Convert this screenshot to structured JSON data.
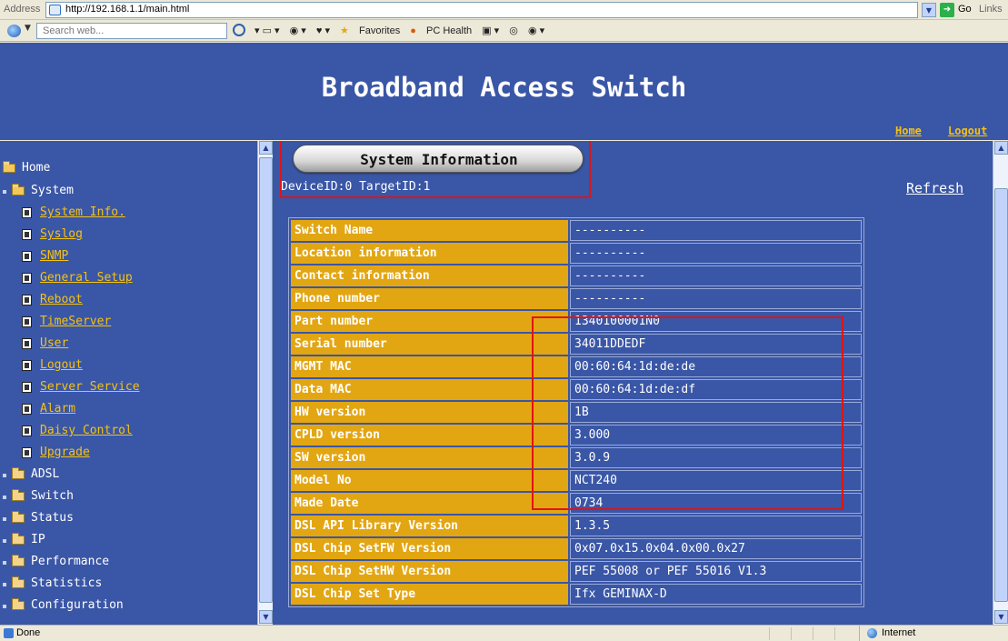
{
  "browser": {
    "address_label": "Address",
    "url": "http://192.168.1.1/main.html",
    "go_label": "Go",
    "links_label": "Links",
    "search_placeholder": "Search web...",
    "favorites_label": "Favorites",
    "pc_health_label": "PC Health",
    "status_text": "Done",
    "zone_text": "Internet"
  },
  "header": {
    "title": "Broadband Access Switch",
    "home_link": "Home",
    "logout_link": "Logout"
  },
  "nav": {
    "root": "Home",
    "system": "System",
    "system_items": [
      "System Info.",
      "Syslog",
      "SNMP",
      "General Setup",
      "Reboot",
      "TimeServer",
      "User",
      "Logout",
      "Server Service",
      "Alarm",
      "Daisy Control",
      "Upgrade"
    ],
    "folders": [
      "ADSL",
      "Switch",
      "Status",
      "IP",
      "Performance",
      "Statistics",
      "Configuration"
    ]
  },
  "main": {
    "section_title": "System Information",
    "device_line": "DeviceID:0 TargetID:1",
    "refresh_label": "Refresh",
    "rows": [
      {
        "key": "Switch Name",
        "value": "----------"
      },
      {
        "key": "Location information",
        "value": "----------"
      },
      {
        "key": "Contact information",
        "value": "----------"
      },
      {
        "key": "Phone number",
        "value": "----------"
      },
      {
        "key": "Part number",
        "value": "1340100001N0"
      },
      {
        "key": "Serial number",
        "value": "34011DDEDF"
      },
      {
        "key": "MGMT MAC",
        "value": "00:60:64:1d:de:de"
      },
      {
        "key": "Data MAC",
        "value": "00:60:64:1d:de:df"
      },
      {
        "key": "HW version",
        "value": "1B"
      },
      {
        "key": "CPLD version",
        "value": "3.000"
      },
      {
        "key": "SW version",
        "value": "3.0.9"
      },
      {
        "key": "Model No",
        "value": "NCT240"
      },
      {
        "key": "Made Date",
        "value": "0734"
      },
      {
        "key": "DSL API Library Version",
        "value": "1.3.5"
      },
      {
        "key": "DSL Chip SetFW Version",
        "value": "0x07.0x15.0x04.0x00.0x27"
      },
      {
        "key": "DSL Chip SetHW Version",
        "value": "PEF 55008 or PEF 55016 V1.3"
      },
      {
        "key": "DSL Chip Set Type",
        "value": "Ifx GEMINAX-D"
      }
    ]
  },
  "colors": {
    "page_blue": "#3a56a6",
    "key_gold": "#e3a613",
    "link_yellow": "#f5c211",
    "highlight_red": "#e01414"
  },
  "icons": {
    "folder": "folder-icon",
    "page": "page-icon",
    "globe": "globe-icon"
  }
}
